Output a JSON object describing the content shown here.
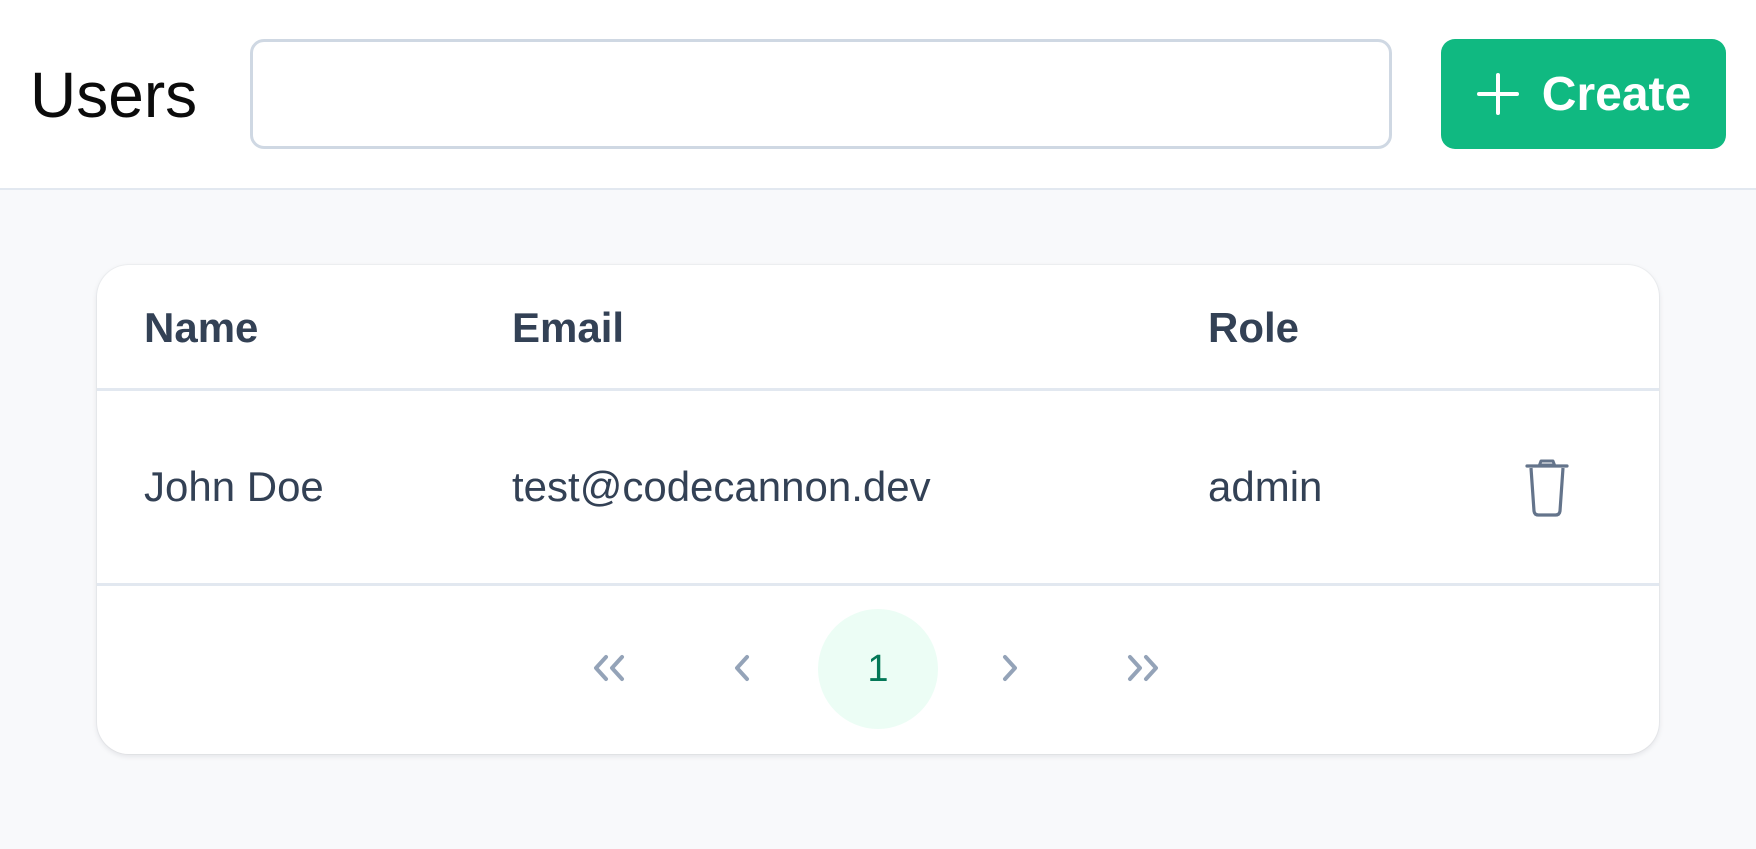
{
  "header": {
    "title": "Users",
    "search": {
      "value": "",
      "placeholder": ""
    },
    "create_button": {
      "label": "Create",
      "icon": "plus-icon"
    }
  },
  "table": {
    "columns": [
      "Name",
      "Email",
      "Role"
    ],
    "rows": [
      {
        "name": "John Doe",
        "email": "test@codecannon.dev",
        "role": "admin",
        "action_icon": "trash-icon"
      }
    ]
  },
  "pagination": {
    "current_page": "1",
    "controls": [
      "first-page-icon",
      "previous-page-icon",
      "next-page-icon",
      "last-page-icon"
    ]
  },
  "colors": {
    "accent": "#10b981",
    "page_background": "#f8f9fb",
    "text": "#334155",
    "current_page_bg": "#ecfdf5",
    "current_page_text": "#047857",
    "muted_icon": "#94a3b8"
  }
}
